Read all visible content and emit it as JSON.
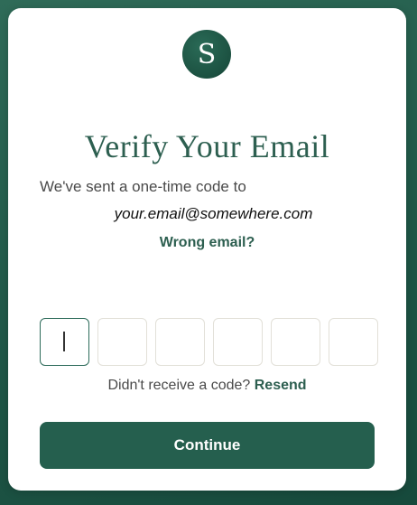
{
  "logo": {
    "letter": "S"
  },
  "title": "Verify Your Email",
  "sent_text": "We've sent a one-time code to",
  "email": "your.email@somewhere.com",
  "wrong_email_label": "Wrong email?",
  "otp": {
    "length": 6,
    "values": [
      "",
      "",
      "",
      "",
      "",
      ""
    ]
  },
  "resend": {
    "prompt": "Didn't receive a code?",
    "link_label": "Resend"
  },
  "continue_label": "Continue",
  "colors": {
    "accent": "#2d5f50",
    "button": "#255f4e",
    "background": "#1f5747"
  }
}
